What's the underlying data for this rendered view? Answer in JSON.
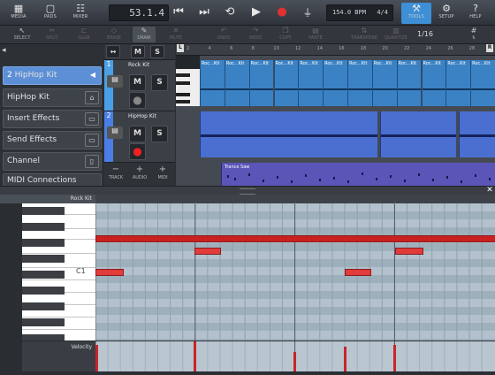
{
  "toolbar": {
    "media": "MEDIA",
    "pads": "PADS",
    "mixer": "MIXER",
    "position": "53.1.4",
    "tempo": "154.0 BPM",
    "signature": "4/4",
    "tools": "TOOLS",
    "setup": "SETUP",
    "help": "HELP"
  },
  "tools2": {
    "select": "SELECT",
    "split": "SPLIT",
    "glue": "GLUE",
    "erase": "ERASE",
    "draw": "DRAW",
    "mute": "MUTE",
    "undo": "UNDO",
    "redo": "REDO",
    "copy": "COPY",
    "paste": "PASTE",
    "transpose": "TRANSPOSE",
    "quantize": "QUANTIZE",
    "quantize_value": "1/16"
  },
  "inspector": {
    "selected_num": "2",
    "selected_label": "HipHop Kit",
    "items": [
      "HipHop Kit",
      "Insert Effects",
      "Send Effects",
      "Channel",
      "MIDI Connections"
    ]
  },
  "tracks": [
    {
      "num": "1",
      "name": "Rock Kit",
      "m": "M",
      "s": "S"
    },
    {
      "num": "2",
      "name": "HipHop Kit",
      "m": "M",
      "s": "S"
    }
  ],
  "track_buttons": {
    "track": "TRACK",
    "audio": "AUDIO",
    "midi": "MIDI"
  },
  "ruler": {
    "left_locator": "L",
    "right_locator": "R",
    "marks": [
      "1",
      "2",
      "3",
      "4",
      "5",
      "6",
      "7",
      "8",
      "9",
      "10",
      "11",
      "12",
      "13",
      "14",
      "15",
      "16",
      "17",
      "18",
      "19",
      "20",
      "21",
      "22",
      "23",
      "24",
      "25",
      "26",
      "27",
      "28",
      "29",
      "30",
      "31",
      "32",
      "33",
      "34",
      "35",
      "36",
      "37",
      "38",
      "39",
      "40",
      "41",
      "42",
      "43",
      "44",
      "45",
      "46",
      "47",
      "48",
      "49",
      "50",
      "51",
      "52",
      "53",
      "54",
      "55",
      "56",
      "57",
      "58",
      "59",
      "60"
    ]
  },
  "clips": {
    "rock_parts": [
      "Roc...",
      "Kit",
      "Roc...",
      "Kit",
      "Roc...",
      "Kit",
      "Roc...",
      "Kit",
      "Roc...",
      "Kit",
      "Roc...",
      "Kit",
      "Roc...",
      "Kit",
      "Roc...",
      "Kit",
      "Roc...",
      "Kit",
      "Roc...",
      "Kit",
      "Roc...",
      "Kit",
      "Roc...",
      "Kit"
    ],
    "trance": "Trance Saw"
  },
  "editor": {
    "track_name": "Rock Kit",
    "key_label": "C1",
    "velocity_label": "Velocity"
  },
  "colors": {
    "accent": "#3e8fd6",
    "clip_blue": "#3b82c4",
    "clip_purple": "#5b55b8",
    "note_red": "#e23b3b"
  }
}
